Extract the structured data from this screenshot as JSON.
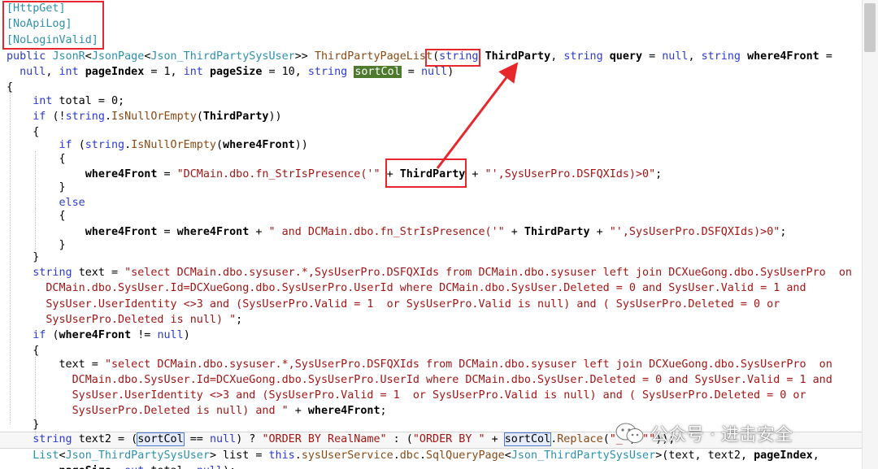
{
  "watermark": {
    "text": "公众号 · 进击安全",
    "icon": "wechat-icon"
  },
  "colors": {
    "keyword": "#2b3bd6",
    "type": "#2b91af",
    "string": "#a31515",
    "method": "#8a4a14",
    "annotation_box": "#e8272d",
    "arrow": "#e8272d",
    "highlight": "#4e7a2e"
  },
  "code": {
    "lines": [
      [
        {
          "c": "at",
          "t": "[HttpGet]"
        }
      ],
      [
        {
          "c": "at",
          "t": "[NoApiLog]"
        }
      ],
      [
        {
          "c": "at",
          "t": "[NoLoginValid]"
        }
      ],
      [
        {
          "c": "kw",
          "t": "public "
        },
        {
          "c": "ty",
          "t": "JsonR"
        },
        {
          "c": "",
          "t": "<"
        },
        {
          "c": "ty",
          "t": "JsonPage"
        },
        {
          "c": "",
          "t": "<"
        },
        {
          "c": "ty",
          "t": "Json_ThirdPartySysUser"
        },
        {
          "c": "",
          "t": ">> "
        },
        {
          "c": "fn",
          "t": "ThirdPartyPageList"
        },
        {
          "c": "",
          "t": "("
        },
        {
          "c": "kw",
          "t": "string "
        },
        {
          "c": "pr",
          "t": "ThirdParty"
        },
        {
          "c": "",
          "t": ", "
        },
        {
          "c": "kw",
          "t": "string "
        },
        {
          "c": "pr",
          "t": "query"
        },
        {
          "c": "",
          "t": " = "
        },
        {
          "c": "kw",
          "t": "null"
        },
        {
          "c": "",
          "t": ", "
        },
        {
          "c": "kw",
          "t": "string "
        },
        {
          "c": "pr",
          "t": "where4Front"
        },
        {
          "c": "",
          "t": " ="
        }
      ],
      [
        {
          "c": "",
          "t": "  "
        },
        {
          "c": "kw",
          "t": "null"
        },
        {
          "c": "",
          "t": ", "
        },
        {
          "c": "kw",
          "t": "int "
        },
        {
          "c": "pr",
          "t": "pageIndex"
        },
        {
          "c": "",
          "t": " = 1, "
        },
        {
          "c": "kw",
          "t": "int "
        },
        {
          "c": "pr",
          "t": "pageSize"
        },
        {
          "c": "",
          "t": " = 10, "
        },
        {
          "c": "kw",
          "t": "string "
        },
        {
          "c": "hlg",
          "t": "sortCol"
        },
        {
          "c": "",
          "t": " = "
        },
        {
          "c": "kw",
          "t": "null"
        },
        {
          "c": "",
          "t": ")"
        }
      ],
      [
        {
          "c": "",
          "t": "{"
        }
      ],
      [
        {
          "c": "",
          "t": "    "
        },
        {
          "c": "kw",
          "t": "int "
        },
        {
          "c": "",
          "t": "total = 0;"
        }
      ],
      [
        {
          "c": "",
          "t": "    "
        },
        {
          "c": "kw",
          "t": "if "
        },
        {
          "c": "",
          "t": "(!"
        },
        {
          "c": "kw",
          "t": "string"
        },
        {
          "c": "",
          "t": "."
        },
        {
          "c": "fn",
          "t": "IsNullOrEmpty"
        },
        {
          "c": "",
          "t": "("
        },
        {
          "c": "pr",
          "t": "ThirdParty"
        },
        {
          "c": "",
          "t": "))"
        }
      ],
      [
        {
          "c": "",
          "t": "    {"
        }
      ],
      [
        {
          "c": "",
          "t": "        "
        },
        {
          "c": "kw",
          "t": "if "
        },
        {
          "c": "",
          "t": "("
        },
        {
          "c": "kw",
          "t": "string"
        },
        {
          "c": "",
          "t": "."
        },
        {
          "c": "fn",
          "t": "IsNullOrEmpty"
        },
        {
          "c": "",
          "t": "("
        },
        {
          "c": "pr",
          "t": "where4Front"
        },
        {
          "c": "",
          "t": "))"
        }
      ],
      [
        {
          "c": "",
          "t": "        {"
        }
      ],
      [
        {
          "c": "",
          "t": "            "
        },
        {
          "c": "pr",
          "t": "where4Front"
        },
        {
          "c": "",
          "t": " = "
        },
        {
          "c": "st",
          "t": "\"DCMain.dbo.fn_StrIsPresence('\""
        },
        {
          "c": "",
          "t": " + "
        },
        {
          "c": "pr",
          "t": "ThirdParty"
        },
        {
          "c": "",
          "t": " + "
        },
        {
          "c": "st",
          "t": "\"',SysUserPro.DSFQXIds)>0\""
        },
        {
          "c": "",
          "t": ";"
        }
      ],
      [
        {
          "c": "",
          "t": "        }"
        }
      ],
      [
        {
          "c": "",
          "t": "        "
        },
        {
          "c": "kw",
          "t": "else"
        }
      ],
      [
        {
          "c": "",
          "t": "        {"
        }
      ],
      [
        {
          "c": "",
          "t": "            "
        },
        {
          "c": "pr",
          "t": "where4Front"
        },
        {
          "c": "",
          "t": " = "
        },
        {
          "c": "pr",
          "t": "where4Front"
        },
        {
          "c": "",
          "t": " + "
        },
        {
          "c": "st",
          "t": "\" and DCMain.dbo.fn_StrIsPresence('\""
        },
        {
          "c": "",
          "t": " + "
        },
        {
          "c": "pr",
          "t": "ThirdParty"
        },
        {
          "c": "",
          "t": " + "
        },
        {
          "c": "st",
          "t": "\"',SysUserPro.DSFQXIds)>0\""
        },
        {
          "c": "",
          "t": ";"
        }
      ],
      [
        {
          "c": "",
          "t": "        }"
        }
      ],
      [
        {
          "c": "",
          "t": "    }"
        }
      ],
      [
        {
          "c": "",
          "t": "    "
        },
        {
          "c": "kw",
          "t": "string "
        },
        {
          "c": "",
          "t": "text = "
        },
        {
          "c": "st",
          "t": "\"select DCMain.dbo.sysuser.*,SysUserPro.DSFQXIds from DCMain.dbo.sysuser left join DCXueGong.dbo.SysUserPro  on"
        }
      ],
      [
        {
          "c": "st",
          "t": "      DCMain.dbo.SysUser.Id=DCXueGong.dbo.SysUserPro.UserId where DCMain.dbo.SysUser.Deleted = 0 and SysUser.Valid = 1 and"
        }
      ],
      [
        {
          "c": "st",
          "t": "      SysUser.UserIdentity <>3 and (SysUserPro.Valid = 1  or SysUserPro.Valid is null) and ( SysUserPro.Deleted = 0 or"
        }
      ],
      [
        {
          "c": "st",
          "t": "      SysUserPro.Deleted is null) \""
        },
        {
          "c": "",
          "t": ";"
        }
      ],
      [
        {
          "c": "",
          "t": "    "
        },
        {
          "c": "kw",
          "t": "if "
        },
        {
          "c": "",
          "t": "("
        },
        {
          "c": "pr",
          "t": "where4Front"
        },
        {
          "c": "",
          "t": " != "
        },
        {
          "c": "kw",
          "t": "null"
        },
        {
          "c": "",
          "t": ")"
        }
      ],
      [
        {
          "c": "",
          "t": "    {"
        }
      ],
      [
        {
          "c": "",
          "t": "        text = "
        },
        {
          "c": "st",
          "t": "\"select DCMain.dbo.sysuser.*,SysUserPro.DSFQXIds from DCMain.dbo.sysuser left join DCXueGong.dbo.SysUserPro  on"
        }
      ],
      [
        {
          "c": "st",
          "t": "          DCMain.dbo.SysUser.Id=DCXueGong.dbo.SysUserPro.UserId where DCMain.dbo.SysUser.Deleted = 0 and SysUser.Valid = 1 and"
        }
      ],
      [
        {
          "c": "st",
          "t": "          SysUser.UserIdentity <>3 and (SysUserPro.Valid = 1  or SysUserPro.Valid is null) and ( SysUserPro.Deleted = 0 or"
        }
      ],
      [
        {
          "c": "st",
          "t": "          SysUserPro.Deleted is null) and \""
        },
        {
          "c": "",
          "t": " + "
        },
        {
          "c": "pr",
          "t": "where4Front"
        },
        {
          "c": "",
          "t": ";"
        }
      ],
      [
        {
          "c": "",
          "t": "    }"
        }
      ],
      [
        {
          "c": "",
          "t": "    "
        },
        {
          "c": "kw",
          "t": "string "
        },
        {
          "c": "",
          "t": "text2 = ("
        },
        {
          "c": "hlr",
          "t": "sortCol"
        },
        {
          "c": "",
          "t": " == "
        },
        {
          "c": "kw",
          "t": "null"
        },
        {
          "c": "",
          "t": ") ? "
        },
        {
          "c": "st",
          "t": "\"ORDER BY RealName\""
        },
        {
          "c": "",
          "t": " : ("
        },
        {
          "c": "st",
          "t": "\"ORDER BY \""
        },
        {
          "c": "",
          "t": " + "
        },
        {
          "c": "hlr",
          "t": "sortCol"
        },
        {
          "c": "",
          "t": "."
        },
        {
          "c": "fn",
          "t": "Replace"
        },
        {
          "c": "",
          "t": "("
        },
        {
          "c": "st",
          "t": "\"_\""
        },
        {
          "c": "",
          "t": ", "
        },
        {
          "c": "st",
          "t": "\"\""
        },
        {
          "c": "",
          "t": "));"
        }
      ],
      [
        {
          "c": "",
          "t": "    "
        },
        {
          "c": "ty",
          "t": "List"
        },
        {
          "c": "",
          "t": "<"
        },
        {
          "c": "ty",
          "t": "Json_ThirdPartySysUser"
        },
        {
          "c": "",
          "t": "> list = "
        },
        {
          "c": "kw",
          "t": "this"
        },
        {
          "c": "",
          "t": "."
        },
        {
          "c": "fn",
          "t": "sysUserService"
        },
        {
          "c": "",
          "t": "."
        },
        {
          "c": "fn",
          "t": "dbc"
        },
        {
          "c": "",
          "t": "."
        },
        {
          "c": "fn",
          "t": "SqlQueryPage"
        },
        {
          "c": "",
          "t": "<"
        },
        {
          "c": "ty",
          "t": "Json_ThirdPartySysUser"
        },
        {
          "c": "",
          "t": ">(text, text2, "
        },
        {
          "c": "pr",
          "t": "pageIndex"
        },
        {
          "c": "",
          "t": ","
        }
      ],
      [
        {
          "c": "",
          "t": "        "
        },
        {
          "c": "pr",
          "t": "pageSize"
        },
        {
          "c": "",
          "t": ", "
        },
        {
          "c": "kw",
          "t": "out "
        },
        {
          "c": "",
          "t": "total, "
        },
        {
          "c": "kw",
          "t": "null"
        },
        {
          "c": "",
          "t": ");"
        }
      ]
    ]
  }
}
